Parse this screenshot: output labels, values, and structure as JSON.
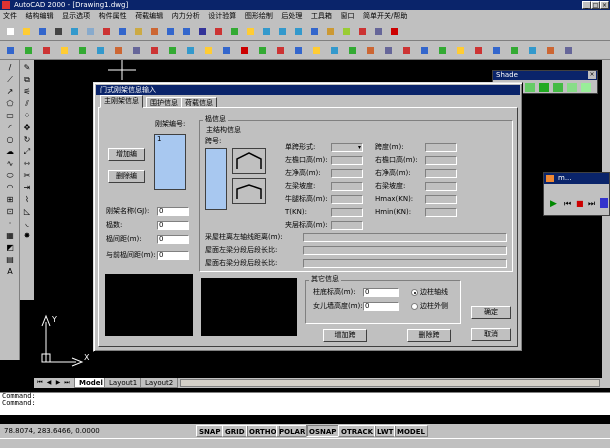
{
  "app": {
    "title": "AutoCAD 2000 - [Drawing1.dwg]"
  },
  "menu": [
    "文件",
    "结构编辑",
    "显示选项",
    "构件属性",
    "荷载编辑",
    "内力分析",
    "设计验算",
    "图形绘制",
    "后处理",
    "工具箱",
    "窗口",
    "简单开关/帮助"
  ],
  "shade": {
    "title": "Shade"
  },
  "player": {
    "title": "m..."
  },
  "dialog": {
    "title": "门式刚架信息输入",
    "tabs": [
      "主刚架信息",
      "围护信息",
      "荷载信息"
    ],
    "frame_list": {
      "header": "刚架编号:",
      "items": [
        "1"
      ],
      "add_button": "增加编",
      "delete_button": "删除编"
    },
    "left_fields": [
      {
        "label": "刚架名称(GJ):",
        "value": "0"
      },
      {
        "label": "榀数:",
        "value": "0"
      },
      {
        "label": "榀间距(m):",
        "value": "0"
      },
      {
        "label": "与前榀间距(m):",
        "value": "0"
      }
    ],
    "frame_info": {
      "group_title": "榀信息",
      "main_title": "主结构信息",
      "span_label": "跨号:",
      "col1": [
        {
          "label": "单跨形式:",
          "value": ""
        },
        {
          "label": "左檐口高(m):",
          "value": ""
        },
        {
          "label": "左净高(m):",
          "value": ""
        },
        {
          "label": "左梁坡度:",
          "value": ""
        },
        {
          "label": "牛腿标高(m):",
          "value": ""
        },
        {
          "label": "T(KN):",
          "value": ""
        },
        {
          "label": "夹层标高(m):",
          "value": ""
        }
      ],
      "col2": [
        {
          "label": "跨度(m):",
          "value": ""
        },
        {
          "label": "右檐口高(m):",
          "value": ""
        },
        {
          "label": "右净高(m):",
          "value": ""
        },
        {
          "label": "右梁坡度:",
          "value": ""
        },
        {
          "label": "Hmax(KN):",
          "value": ""
        },
        {
          "label": "Hmin(KN):",
          "value": ""
        }
      ],
      "long_fields": [
        "采屋柱离左轴线距离(m):",
        "屋面左梁分段后段长比:",
        "屋面右梁分段后段长比:"
      ]
    },
    "other": {
      "title": "其它信息",
      "fields": [
        {
          "label": "柱底标高(m):",
          "value": "0"
        },
        {
          "label": "女儿墙高度(m):",
          "value": "0"
        }
      ],
      "radios": [
        {
          "label": "边柱轴线",
          "checked": true
        },
        {
          "label": "边柱外侧",
          "checked": false
        }
      ],
      "add_span": "增加跨",
      "delete_span": "删除跨"
    },
    "ok": "确定",
    "cancel": "取消"
  },
  "layout_tabs": [
    "Model",
    "Layout1",
    "Layout2"
  ],
  "command": {
    "line1": "Command:",
    "line2": "Command:"
  },
  "status": {
    "coords": "78.8074, 283.6466, 0.0000",
    "toggles": [
      "SNAP",
      "GRID",
      "ORTHO",
      "POLAR",
      "OSNAP",
      "OTRACK",
      "LWT",
      "MODEL"
    ]
  }
}
